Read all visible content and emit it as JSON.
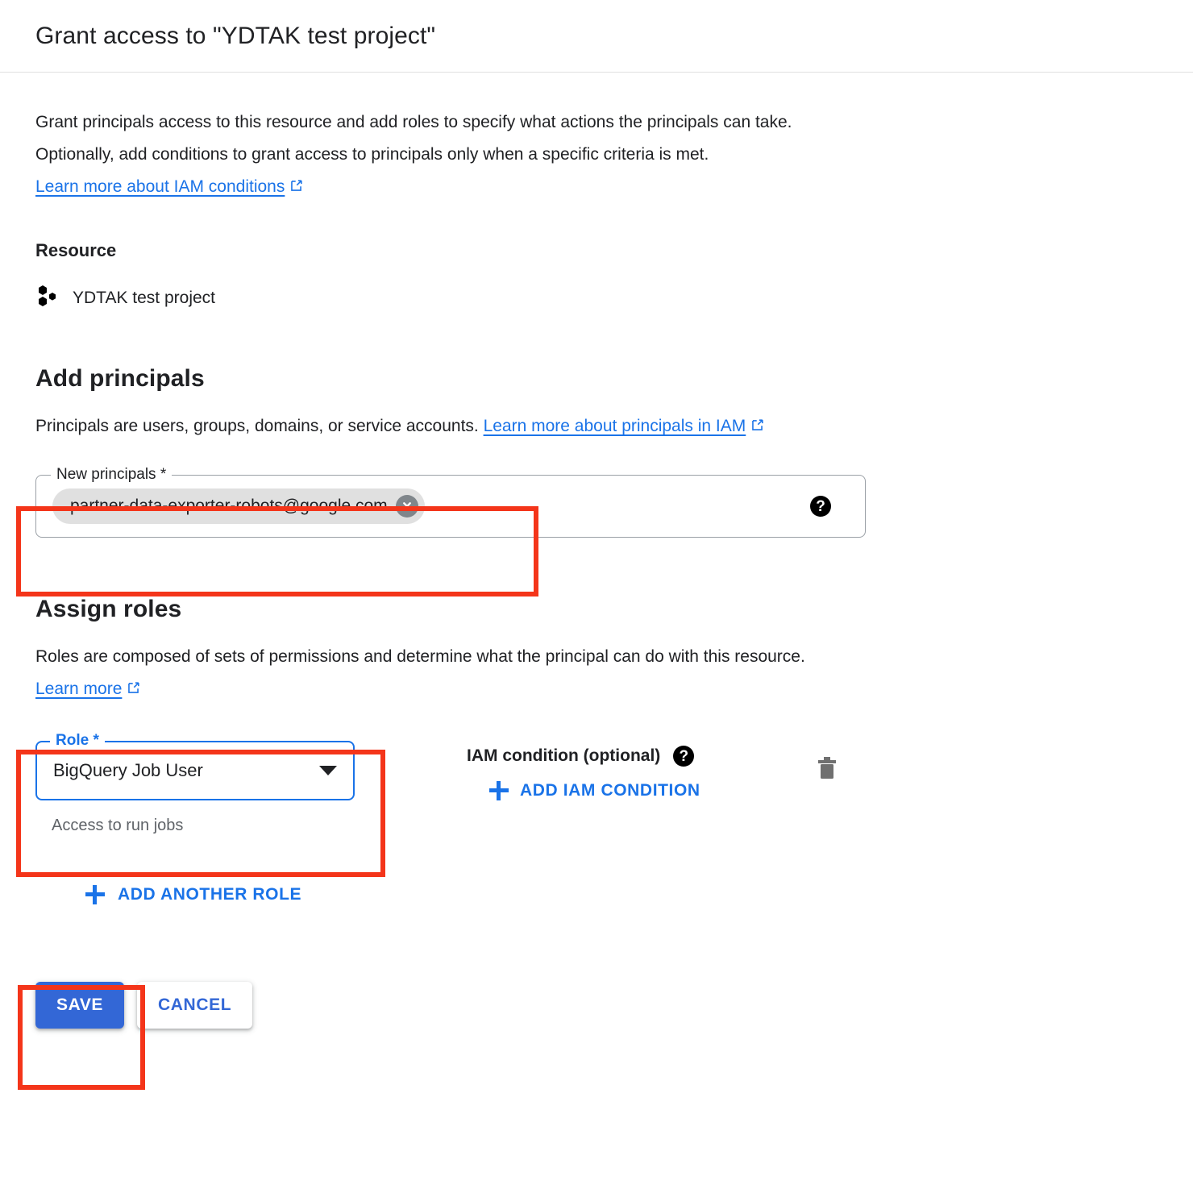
{
  "dialog": {
    "title": "Grant access to \"YDTAK test project\"",
    "intro": {
      "text_before_link": "Grant principals access to this resource and add roles to specify what actions the principals can take. Optionally, add conditions to grant access to principals only when a specific criteria is met. ",
      "link_label": "Learn more about IAM conditions",
      "link_icon": "external-link-icon"
    }
  },
  "resource": {
    "heading": "Resource",
    "icon": "cloud-project-icon",
    "name": "YDTAK test project"
  },
  "add_principals": {
    "heading": "Add principals",
    "description_before_link": "Principals are users, groups, domains, or service accounts. ",
    "link_label": "Learn more about principals in IAM",
    "link_icon": "external-link-icon",
    "field": {
      "label": "New principals *",
      "chip_value": "partner-data-exporter-robots@google.com",
      "chip_remove_icon": "close-circle-icon",
      "help_icon": "help-icon",
      "placeholder": ""
    }
  },
  "assign_roles": {
    "heading": "Assign roles",
    "description_before_link": "Roles are composed of sets of permissions and determine what the principal can do with this resource. ",
    "link_label": "Learn more",
    "link_icon": "external-link-icon",
    "role_field": {
      "label": "Role *",
      "value": "BigQuery Job User",
      "dropdown_icon": "chevron-down-icon",
      "hint": "Access to run jobs"
    },
    "condition": {
      "label": "IAM condition (optional)",
      "help_icon": "help-icon",
      "add_button_label": "ADD IAM CONDITION",
      "add_button_icon": "plus-icon"
    },
    "delete_icon": "trash-icon",
    "add_another_role_label": "ADD ANOTHER ROLE",
    "add_another_role_icon": "plus-icon"
  },
  "actions": {
    "save_label": "SAVE",
    "cancel_label": "CANCEL"
  },
  "colors": {
    "link_blue": "#1a73e8",
    "primary_button": "#3367d6",
    "annotation_red": "#f4351a",
    "chip_background": "#e0e0e0",
    "hint_gray": "#5f6368"
  }
}
